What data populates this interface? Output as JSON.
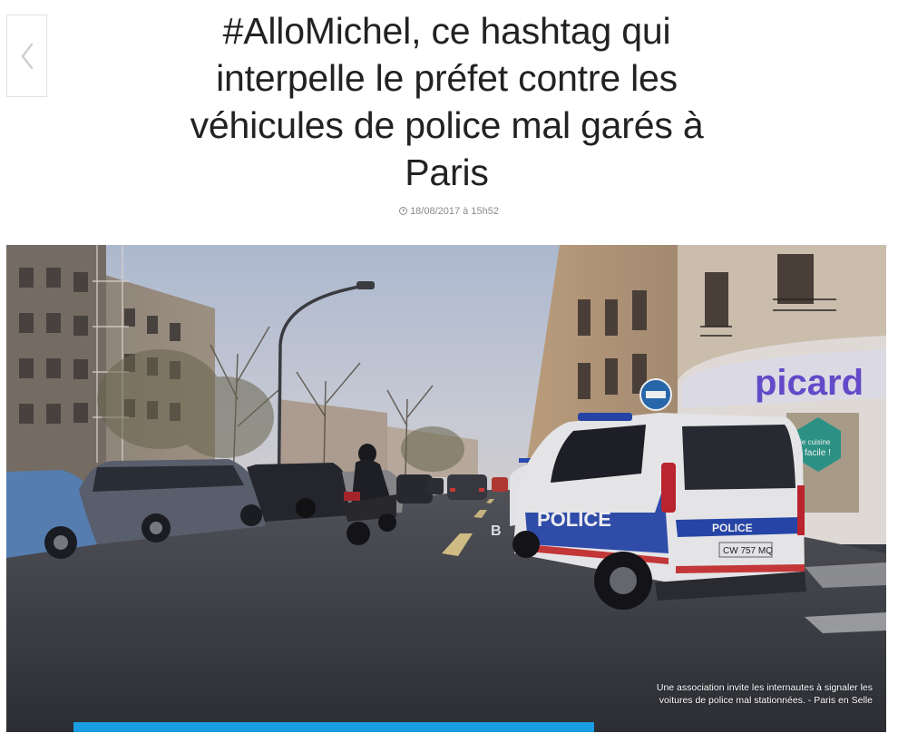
{
  "article": {
    "title": "#AlloMichel, ce hashtag qui interpelle le préfet contre les véhicules de police mal garés à Paris",
    "date": "18/08/2017 à 15h52"
  },
  "navigation": {
    "back_icon": "chevron-left-icon"
  },
  "image": {
    "caption": "Une association invite les internautes à signaler les voitures de police mal stationnées. - Paris en Selle",
    "storefront_sign": "picard",
    "van_text": "POLICE",
    "van_rear_text": "POLICE",
    "plate": "CW 757 MQ"
  },
  "colors": {
    "accent": "#1a9ce0",
    "title": "#222222",
    "meta": "#8a8a8a"
  }
}
